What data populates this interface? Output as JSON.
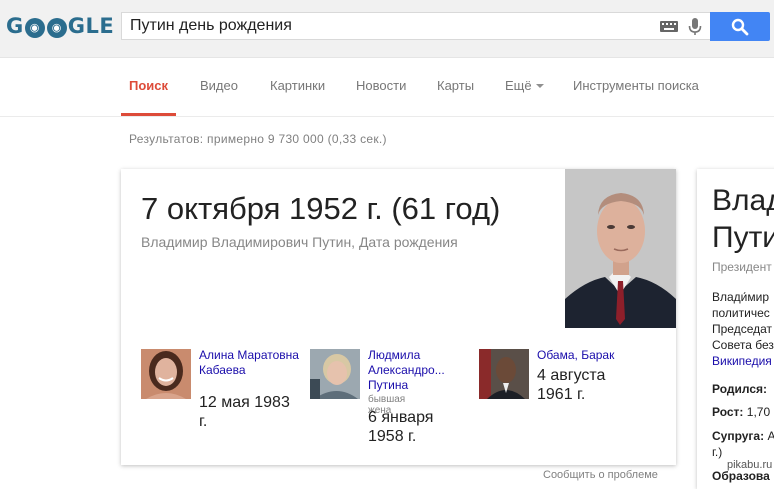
{
  "header": {
    "logo_text": "GOOGLE",
    "search_query": "Путин день рождения",
    "icons": {
      "keyboard": "keyboard-icon",
      "mic": "microphone-icon",
      "search": "search-icon"
    },
    "colors": {
      "accent": "#4285f4",
      "logo": "#2b6d8e"
    }
  },
  "tabs": [
    {
      "label": "Поиск",
      "active": true
    },
    {
      "label": "Видео"
    },
    {
      "label": "Картинки"
    },
    {
      "label": "Новости"
    },
    {
      "label": "Карты"
    },
    {
      "label": "Ещё"
    },
    {
      "label": "Инструменты поиска"
    }
  ],
  "results_stats": "Результатов: примерно 9 730 000 (0,33 сек.)",
  "answer_card": {
    "answer": "7 октября 1952 г. (61 год)",
    "subtitle": "Владимир Владимирович Путин, Дата рождения",
    "related": [
      {
        "name": "Алина Маратовна Кабаева",
        "date": "12 мая 1983 г."
      },
      {
        "name": "Людмила Александро...",
        "name_line2": "Путина",
        "note": "бывшая жена",
        "date": "6 января 1958 г."
      },
      {
        "name": "Обама, Барак",
        "date": "4 августа 1961 г."
      }
    ],
    "report_link": "Сообщить о проблеме"
  },
  "knowledge_panel": {
    "title_line1": "Влад",
    "title_line2": "Пути",
    "type": "Президент",
    "desc_lines": [
      "Влади́мир",
      "политичес",
      "Председат",
      "Совета без"
    ],
    "wiki": "Википедия",
    "facts": [
      {
        "label": "Родился:",
        "value": ""
      },
      {
        "label": "Рост:",
        "value": "1,70"
      },
      {
        "label": "Супруга:",
        "value": "А"
      },
      {
        "label": "",
        "value": "г.)"
      },
      {
        "label": "Образова",
        "value": ""
      }
    ]
  },
  "watermark": "pikabu.ru"
}
